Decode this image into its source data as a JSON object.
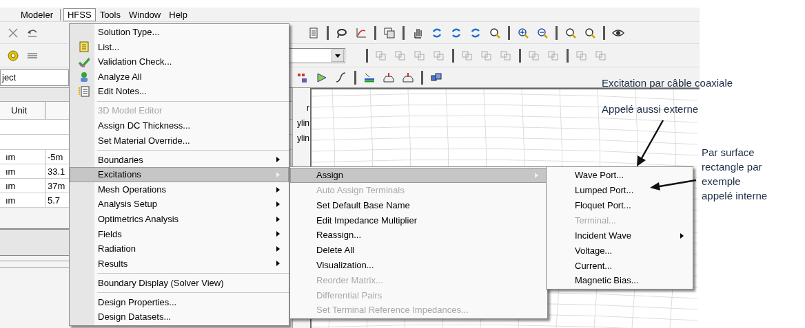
{
  "menubar": [
    {
      "label": "Modeler",
      "selected": false
    },
    {
      "label": "HFSS",
      "selected": true
    },
    {
      "label": "Tools",
      "selected": false
    },
    {
      "label": "Window",
      "selected": false
    },
    {
      "label": "Help",
      "selected": false
    }
  ],
  "object_field": {
    "value": "ject"
  },
  "table": {
    "columns": [
      "Unit"
    ],
    "rows": [
      {
        "unit": "ım",
        "column_2": "-5m"
      },
      {
        "unit": "ım",
        "column_2": "33.1"
      },
      {
        "unit": "ım",
        "column_2": "37m"
      },
      {
        "unit": "ım",
        "column_2": "5.7"
      }
    ]
  },
  "tree_fragments": [
    "r",
    "ylin",
    "ylin"
  ],
  "hfss_menu": [
    {
      "kind": "item",
      "label": "Solution Type...",
      "has_icon": false,
      "disabled": false,
      "submenu": false,
      "selected": false
    },
    {
      "kind": "item",
      "label": "List...",
      "has_icon": true,
      "disabled": false,
      "submenu": false,
      "selected": false
    },
    {
      "kind": "item",
      "label": "Validation Check...",
      "has_icon": true,
      "disabled": false,
      "submenu": false,
      "selected": false
    },
    {
      "kind": "item",
      "label": "Analyze All",
      "has_icon": true,
      "disabled": false,
      "submenu": false,
      "selected": false
    },
    {
      "kind": "item",
      "label": "Edit Notes...",
      "has_icon": true,
      "disabled": false,
      "submenu": false,
      "selected": false
    },
    {
      "kind": "separator"
    },
    {
      "kind": "item",
      "label": "3D Model Editor",
      "has_icon": false,
      "disabled": true,
      "submenu": false,
      "selected": false
    },
    {
      "kind": "item",
      "label": "Assign DC Thickness...",
      "has_icon": false,
      "disabled": false,
      "submenu": false,
      "selected": false
    },
    {
      "kind": "item",
      "label": "Set Material Override...",
      "has_icon": false,
      "disabled": false,
      "submenu": false,
      "selected": false
    },
    {
      "kind": "separator"
    },
    {
      "kind": "item",
      "label": "Boundaries",
      "has_icon": false,
      "disabled": false,
      "submenu": true,
      "selected": false
    },
    {
      "kind": "item",
      "label": "Excitations",
      "has_icon": false,
      "disabled": false,
      "submenu": true,
      "selected": true
    },
    {
      "kind": "item",
      "label": "Mesh Operations",
      "has_icon": false,
      "disabled": false,
      "submenu": true,
      "selected": false
    },
    {
      "kind": "item",
      "label": "Analysis Setup",
      "has_icon": false,
      "disabled": false,
      "submenu": true,
      "selected": false
    },
    {
      "kind": "item",
      "label": "Optimetrics Analysis",
      "has_icon": false,
      "disabled": false,
      "submenu": true,
      "selected": false
    },
    {
      "kind": "item",
      "label": "Fields",
      "has_icon": false,
      "disabled": false,
      "submenu": true,
      "selected": false
    },
    {
      "kind": "item",
      "label": "Radiation",
      "has_icon": false,
      "disabled": false,
      "submenu": true,
      "selected": false
    },
    {
      "kind": "item",
      "label": "Results",
      "has_icon": false,
      "disabled": false,
      "submenu": true,
      "selected": false
    },
    {
      "kind": "separator"
    },
    {
      "kind": "item",
      "label": "Boundary Display (Solver View)",
      "has_icon": false,
      "disabled": false,
      "submenu": false,
      "selected": false
    },
    {
      "kind": "separator"
    },
    {
      "kind": "item",
      "label": "Design Properties...",
      "has_icon": false,
      "disabled": false,
      "submenu": false,
      "selected": false
    },
    {
      "kind": "item",
      "label": "Design Datasets...",
      "has_icon": false,
      "disabled": false,
      "submenu": false,
      "selected": false
    }
  ],
  "excitations_menu": [
    {
      "kind": "item",
      "label": "Assign",
      "disabled": false,
      "submenu": true,
      "selected": true
    },
    {
      "kind": "item",
      "label": "Auto Assign Terminals",
      "disabled": true,
      "submenu": false,
      "selected": false
    },
    {
      "kind": "item",
      "label": "Set Default Base Name",
      "disabled": false,
      "submenu": false,
      "selected": false
    },
    {
      "kind": "item",
      "label": "Edit Impedance Multiplier",
      "disabled": false,
      "submenu": false,
      "selected": false
    },
    {
      "kind": "item",
      "label": "Reassign...",
      "disabled": false,
      "submenu": false,
      "selected": false
    },
    {
      "kind": "item",
      "label": "Delete All",
      "disabled": false,
      "submenu": false,
      "selected": false
    },
    {
      "kind": "item",
      "label": "Visualization...",
      "disabled": false,
      "submenu": false,
      "selected": false
    },
    {
      "kind": "item",
      "label": "Reorder Matrix...",
      "disabled": true,
      "submenu": false,
      "selected": false
    },
    {
      "kind": "item",
      "label": "Differential Pairs",
      "disabled": true,
      "submenu": false,
      "selected": false
    },
    {
      "kind": "item",
      "label": "Set Terminal Reference Impedances...",
      "disabled": true,
      "submenu": false,
      "selected": false
    }
  ],
  "assign_menu": [
    {
      "kind": "item",
      "label": "Wave Port...",
      "disabled": false,
      "submenu": false,
      "selected": false
    },
    {
      "kind": "item",
      "label": "Lumped Port...",
      "disabled": false,
      "submenu": false,
      "selected": false
    },
    {
      "kind": "item",
      "label": "Floquet Port...",
      "disabled": false,
      "submenu": false,
      "selected": false
    },
    {
      "kind": "item",
      "label": "Terminal...",
      "disabled": true,
      "submenu": false,
      "selected": false
    },
    {
      "kind": "item",
      "label": "Incident Wave",
      "disabled": false,
      "submenu": true,
      "selected": false
    },
    {
      "kind": "item",
      "label": "Voltage...",
      "disabled": false,
      "submenu": false,
      "selected": false
    },
    {
      "kind": "item",
      "label": "Current...",
      "disabled": false,
      "submenu": false,
      "selected": false
    },
    {
      "kind": "item",
      "label": "Magnetic Bias...",
      "disabled": false,
      "submenu": false,
      "selected": false
    }
  ],
  "annotations": [
    {
      "lines": [
        "Excitation par câble coaxiale"
      ]
    },
    {
      "lines": [
        "Appelé aussi externe"
      ]
    },
    {
      "lines": [
        "Par surface",
        "rectangle par",
        "exemple",
        "appelé interne"
      ]
    }
  ]
}
